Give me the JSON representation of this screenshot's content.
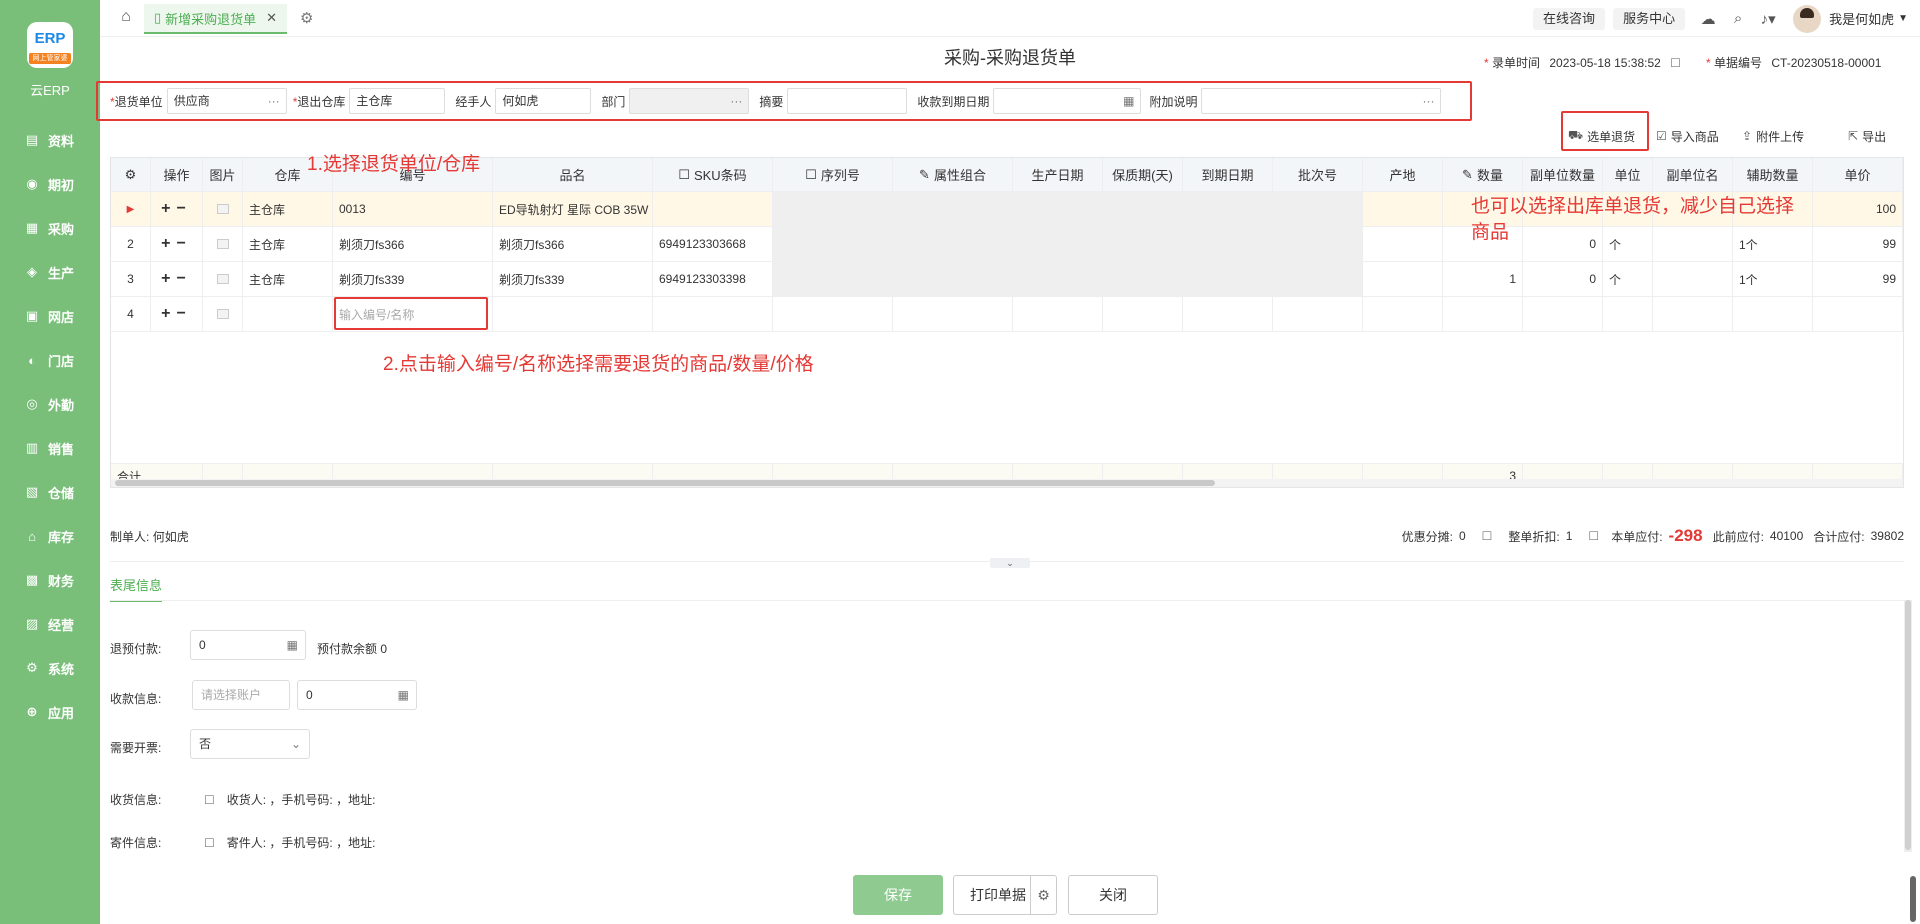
{
  "sidebar": {
    "logo_text": "ERP",
    "logo_tag": "网上管家婆",
    "logo_caption": "云ERP",
    "items": [
      {
        "label": "资料",
        "icon": "database-icon"
      },
      {
        "label": "期初",
        "icon": "clock-icon"
      },
      {
        "label": "采购",
        "icon": "purchase-icon"
      },
      {
        "label": "生产",
        "icon": "production-icon"
      },
      {
        "label": "网店",
        "icon": "shop-icon"
      },
      {
        "label": "门店",
        "icon": "store-icon"
      },
      {
        "label": "外勤",
        "icon": "field-icon"
      },
      {
        "label": "销售",
        "icon": "sales-icon"
      },
      {
        "label": "仓储",
        "icon": "warehouse-icon"
      },
      {
        "label": "库存",
        "icon": "inventory-icon"
      },
      {
        "label": "财务",
        "icon": "finance-icon"
      },
      {
        "label": "经营",
        "icon": "business-icon"
      },
      {
        "label": "系统",
        "icon": "system-icon"
      },
      {
        "label": "应用",
        "icon": "apps-icon"
      }
    ]
  },
  "topbar": {
    "tab_label": "新增采购退货单",
    "online_consult": "在线咨询",
    "service_center": "服务中心",
    "user_name": "我是何如虎"
  },
  "header": {
    "title": "采购-采购退货单",
    "entry_time_label": "录单时间",
    "entry_time": "2023-05-18 15:38:52",
    "doc_no_label": "单据编号",
    "doc_no": "CT-20230518-00001"
  },
  "form": {
    "return_unit_label": "退货单位",
    "return_unit": "供应商",
    "warehouse_label": "退出仓库",
    "warehouse": "主仓库",
    "handler_label": "经手人",
    "handler": "何如虎",
    "dept_label": "部门",
    "dept": "",
    "summary_label": "摘要",
    "summary": "",
    "due_date_label": "收款到期日期",
    "due_date": "",
    "note_label": "附加说明",
    "note": ""
  },
  "toolbar": {
    "select_order": "选单退货",
    "import_goods": "导入商品",
    "attach_upload": "附件上传",
    "export": "导出"
  },
  "table": {
    "headers": [
      "操作",
      "图片",
      "仓库",
      "编号",
      "品名",
      "SKU条码",
      "序列号",
      "属性组合",
      "生产日期",
      "保质期(天)",
      "到期日期",
      "批次号",
      "产地",
      "数量",
      "副单位数量",
      "单位",
      "副单位名",
      "辅助数量",
      "单价"
    ],
    "rows": [
      {
        "no": "",
        "warehouse": "主仓库",
        "code": "0013",
        "name": "ED导轨射灯 星际 COB 35W",
        "sku": "",
        "qty": "",
        "subqty": "",
        "unit": "",
        "aux": "",
        "price": "100"
      },
      {
        "no": "2",
        "warehouse": "主仓库",
        "code": "剃须刀fs366",
        "name": "剃须刀fs366",
        "sku": "6949123303668",
        "qty": "",
        "subqty": "0",
        "unit": "个",
        "aux": "1个",
        "price": "99"
      },
      {
        "no": "3",
        "warehouse": "主仓库",
        "code": "剃须刀fs339",
        "name": "剃须刀fs339",
        "sku": "6949123303398",
        "qty": "1",
        "subqty": "0",
        "unit": "个",
        "aux": "1个",
        "price": "99"
      },
      {
        "no": "4",
        "warehouse": "",
        "code_placeholder": "输入编号/名称",
        "name": "",
        "sku": "",
        "qty": "",
        "subqty": "",
        "unit": "",
        "aux": "",
        "price": ""
      }
    ],
    "total_label": "合计",
    "total_qty": "3"
  },
  "annotations": {
    "step1": "1.选择退货单位/仓库",
    "step2": "2.点击输入编号/名称选择需要退货的商品/数量/价格",
    "tip": "也可以选择出库单退货，减少自己选择商品"
  },
  "footer": {
    "maker_label": "制单人:",
    "maker": "何如虎",
    "discount_label": "优惠分摊:",
    "discount": "0",
    "whole_discount_label": "整单折扣:",
    "whole_discount": "1",
    "payable_label": "本单应付:",
    "payable": "-298",
    "prev_payable_label": "此前应付:",
    "prev_payable": "40100",
    "total_payable_label": "合计应付:",
    "total_payable": "39802"
  },
  "tail": {
    "tab": "表尾信息",
    "prepay_label": "退预付款:",
    "prepay": "0",
    "prepay_balance": "预付款余额 0",
    "receipt_label": "收款信息:",
    "account_placeholder": "请选择账户",
    "receipt_amount": "0",
    "invoice_label": "需要开票:",
    "invoice": "否",
    "receive_label": "收货信息:",
    "receive_text": "收货人: ，手机号码: ，地址:",
    "send_label": "寄件信息:",
    "send_text": "寄件人: ，手机号码: ，地址:"
  },
  "buttons": {
    "save": "保存",
    "print": "打印单据",
    "close": "关闭"
  }
}
